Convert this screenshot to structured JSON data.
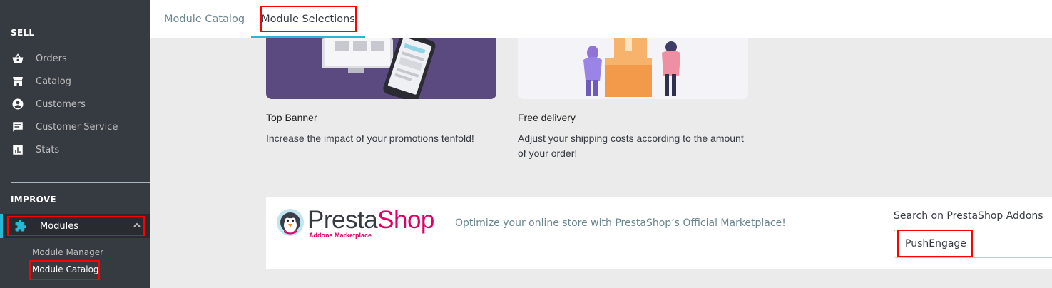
{
  "sidebar": {
    "sections": [
      {
        "title": "SELL"
      },
      {
        "title": "IMPROVE"
      }
    ],
    "sell_items": [
      {
        "label": "Orders",
        "icon": "basket-icon"
      },
      {
        "label": "Catalog",
        "icon": "store-icon"
      },
      {
        "label": "Customers",
        "icon": "account-circle-icon"
      },
      {
        "label": "Customer Service",
        "icon": "chat-icon"
      },
      {
        "label": "Stats",
        "icon": "bar-chart-icon"
      }
    ],
    "modules": {
      "label": "Modules",
      "icon": "puzzle-icon",
      "expanded": true
    },
    "module_submenu": [
      {
        "label": "Module Manager"
      },
      {
        "label": "Module Catalog",
        "active": true
      }
    ]
  },
  "tabs": [
    {
      "label": "Module Catalog",
      "active": false
    },
    {
      "label": "Module Selections",
      "active": true
    }
  ],
  "cards": [
    {
      "title": "Top Banner",
      "description": "Increase the impact of your promotions tenfold!"
    },
    {
      "title": "Free delivery",
      "description_line1": "Adjust your shipping costs according to the amount",
      "description_line2": "of your order!"
    }
  ],
  "addons": {
    "logo_part1": "Presta",
    "logo_part2": "Shop",
    "logo_sub": "Addons Marketplace",
    "tagline": "Optimize your online store with PrestaShop’s Official Marketplace!",
    "search_label": "Search on PrestaShop Addons",
    "search_value": "PushEngage"
  },
  "colors": {
    "sidebar_bg": "#363a41",
    "accent": "#25b9d7",
    "brand_pink": "#df0067",
    "highlight_box": "#ff0000"
  }
}
